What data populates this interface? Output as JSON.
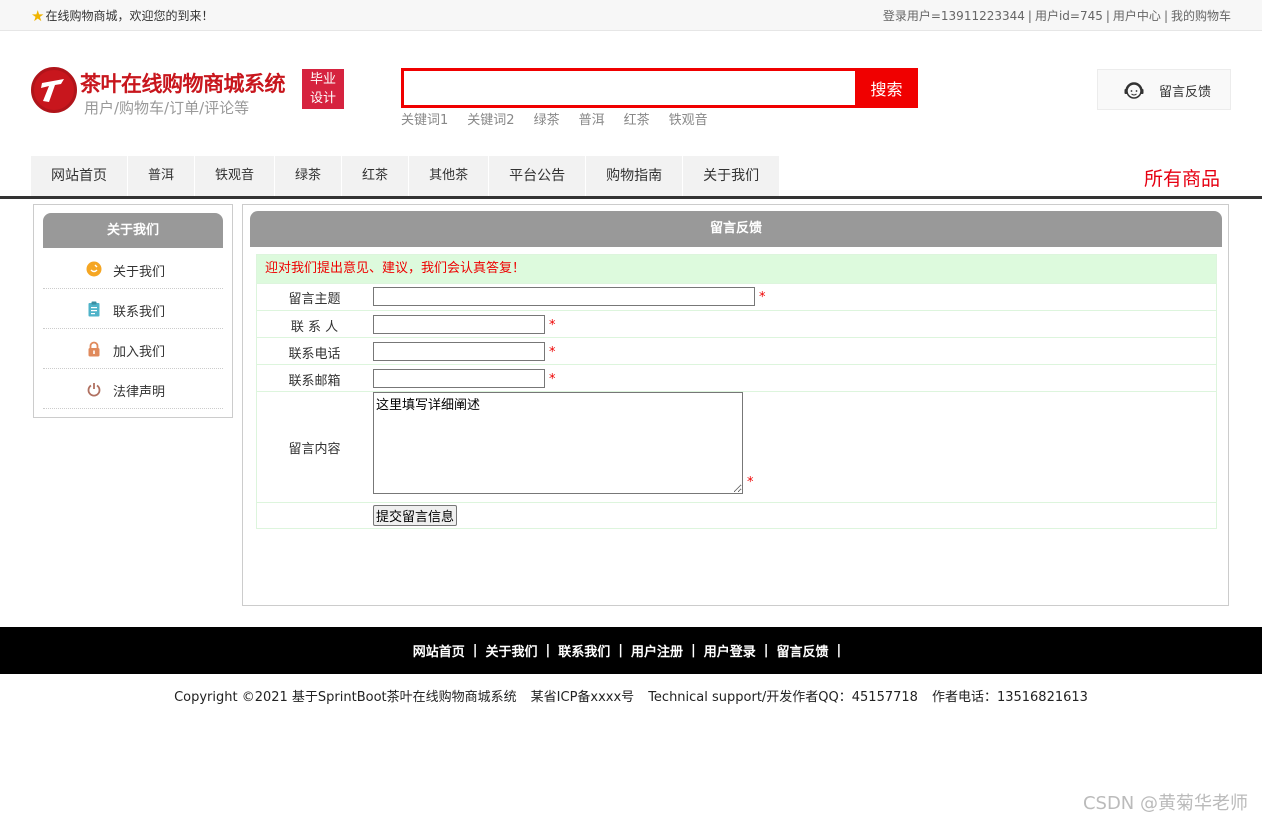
{
  "topbar": {
    "welcome": "在线购物商城，欢迎您的到来！",
    "links": [
      "登录用户=13911223344",
      "用户id=745",
      "用户中心",
      "我的购物车"
    ]
  },
  "header": {
    "title": "茶叶在线购物商城系统",
    "subtitle": "用户/购物车/订单/评论等",
    "badge_line1": "毕业",
    "badge_line2": "设计",
    "search_button": "搜索",
    "search_value": "",
    "hotwords": [
      "关键词1",
      "关键词2",
      "绿茶",
      "普洱",
      "红茶",
      "铁观音"
    ],
    "feedback": "留言反馈"
  },
  "nav": {
    "items": [
      "网站首页",
      "普洱",
      "铁观音",
      "绿茶",
      "红茶",
      "其他茶",
      "平台公告",
      "购物指南",
      "关于我们"
    ],
    "all_goods": "所有商品"
  },
  "sidebar": {
    "title": "关于我们",
    "items": [
      "关于我们",
      "联系我们",
      "加入我们",
      "法律声明"
    ]
  },
  "main": {
    "title": "留言反馈",
    "notice": "迎对我们提出意见、建议，我们会认真答复！",
    "fields": {
      "subject_label": "留言主题",
      "contact_label": "联 系 人",
      "phone_label": "联系电话",
      "email_label": "联系邮箱",
      "content_label": "留言内容",
      "content_value": "这里填写详细阐述"
    },
    "required_mark": "*",
    "submit": "提交留言信息"
  },
  "footer": {
    "links": [
      "网站首页",
      "关于我们",
      "联系我们",
      "用户注册",
      "用户登录",
      "留言反馈"
    ],
    "separator": "|",
    "copyright": "Copyright ©2021 基于SprintBoot茶叶在线购物商城系统",
    "icp": "某省ICP备xxxx号",
    "support": "Technical support/开发作者QQ：45157718",
    "phone": "作者电话：13516821613"
  },
  "watermark": "CSDN @黄菊华老师",
  "colors": {
    "brand_red": "#c8161d",
    "search_red": "#f00000",
    "panel_gray": "#999999",
    "notice_green": "#ddfadd"
  }
}
